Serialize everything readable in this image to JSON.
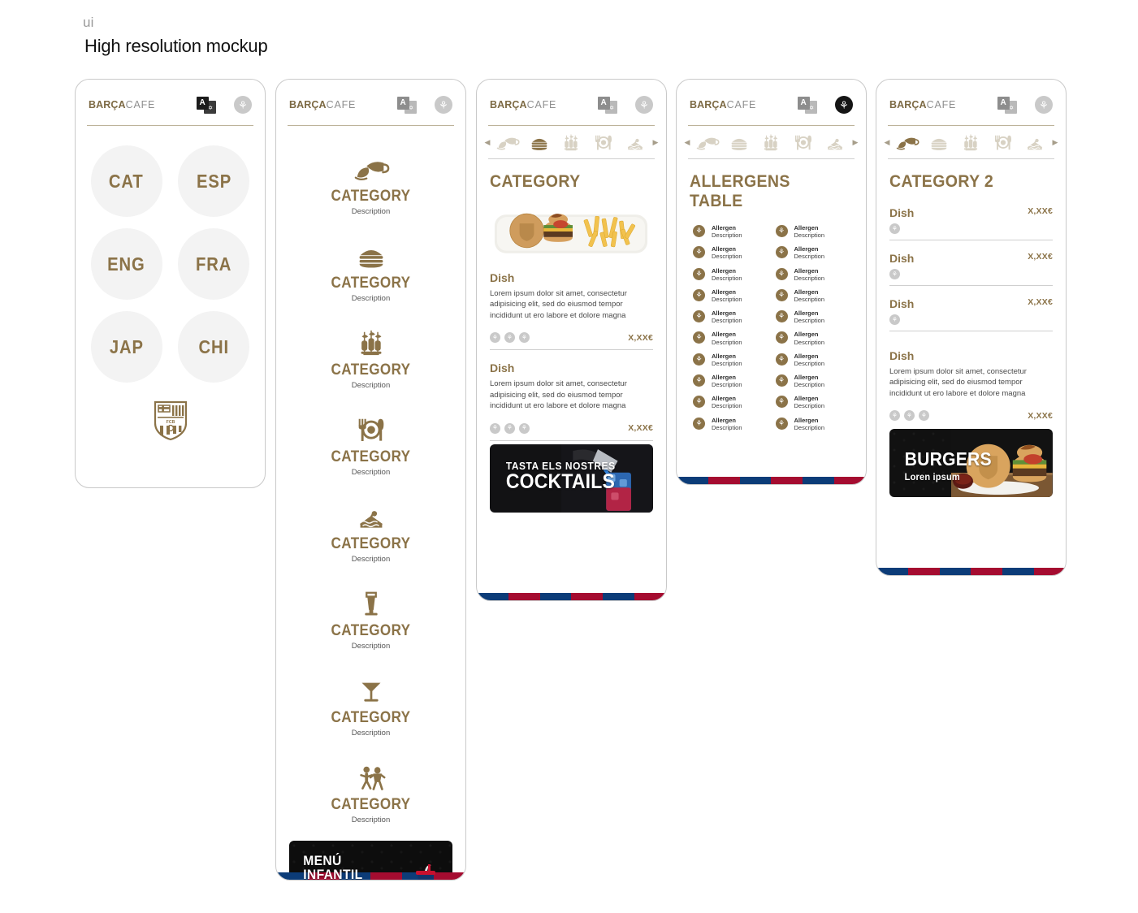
{
  "page": {
    "eyebrow": "ui",
    "title": "High resolution mockup"
  },
  "brand": {
    "name_bold": "BARÇA",
    "name_light": "CAFE",
    "gold": "#8b7348",
    "stripe_blue": "#0c3c78",
    "stripe_red": "#a50c30"
  },
  "header_icons": {
    "translate": "translate-icon",
    "translate_letter": "A",
    "translate_glyph": "✡",
    "allergen": "wheat-icon",
    "allergen_glyph": "⚘"
  },
  "screens": [
    {
      "id": "language-select",
      "languages": [
        "CAT",
        "ESP",
        "ENG",
        "FRA",
        "JAP",
        "CHI"
      ],
      "crest": "fc-barcelona-crest"
    },
    {
      "id": "category-list",
      "categories": [
        {
          "label": "CATEGORY",
          "desc": "Description",
          "icon": "coffee-croissant-icon"
        },
        {
          "label": "CATEGORY",
          "desc": "Description",
          "icon": "burger-icon"
        },
        {
          "label": "CATEGORY",
          "desc": "Description",
          "icon": "tapas-skewers-icon"
        },
        {
          "label": "CATEGORY",
          "desc": "Description",
          "icon": "plate-cutlery-icon"
        },
        {
          "label": "CATEGORY",
          "desc": "Description",
          "icon": "cake-slice-icon"
        },
        {
          "label": "CATEGORY",
          "desc": "Description",
          "icon": "beer-glass-icon"
        },
        {
          "label": "CATEGORY",
          "desc": "Description",
          "icon": "cocktail-glass-icon"
        },
        {
          "label": "CATEGORY",
          "desc": "Description",
          "icon": "kids-icon"
        }
      ],
      "promo": {
        "line1": "MENÚ",
        "line2": "INFANTIL",
        "art": "kids-burger-drink"
      }
    },
    {
      "id": "category-detail",
      "nav_icons": [
        "coffee-croissant-icon",
        "burger-icon",
        "tapas-skewers-icon",
        "plate-cutlery-icon",
        "cake-slice-icon"
      ],
      "nav_active_index": 1,
      "arrow_left": "◀",
      "arrow_right": "▶",
      "title": "CATEGORY",
      "hero_photo": "burger-and-fries-plate",
      "dishes": [
        {
          "name": "Dish",
          "desc": "Lorem ipsum dolor sit amet, consectetur adipisicing elit, sed do eiusmod tempor incididunt ut ero labore et dolore magna",
          "badges": 3,
          "price": "X,XX€"
        },
        {
          "name": "Dish",
          "desc": "Lorem ipsum dolor sit amet, consectetur adipisicing elit, sed do eiusmod tempor incididunt ut ero labore et dolore magna",
          "badges": 3,
          "price": "X,XX€"
        }
      ],
      "promo": {
        "line1": "TASTA ELS NOSTRES",
        "line2": "COCKTAILS",
        "art": "bartender-pouring-cocktail"
      }
    },
    {
      "id": "allergens",
      "nav_active_index": -1,
      "title": "ALLERGENS TABLE",
      "allergen_count": 20,
      "allergen_name": "Allergen",
      "allergen_desc": "Description"
    },
    {
      "id": "category-2",
      "nav_active_index": 0,
      "title": "CATEGORY 2",
      "compact_dishes": [
        {
          "name": "Dish",
          "price": "X,XX€",
          "badges": 1
        },
        {
          "name": "Dish",
          "price": "X,XX€",
          "badges": 1
        },
        {
          "name": "Dish",
          "price": "X,XX€",
          "badges": 1
        }
      ],
      "full_dish": {
        "name": "Dish",
        "desc": "Lorem ipsum dolor sit amet, consectetur adipisicing elit, sed do eiusmod tempor incididunt ut ero labore et dolore magna",
        "badges": 3,
        "price": "X,XX€"
      },
      "promo": {
        "line1": "BURGERS",
        "line2": "Loren ipsum",
        "art": "burger-bun-crest"
      }
    }
  ]
}
